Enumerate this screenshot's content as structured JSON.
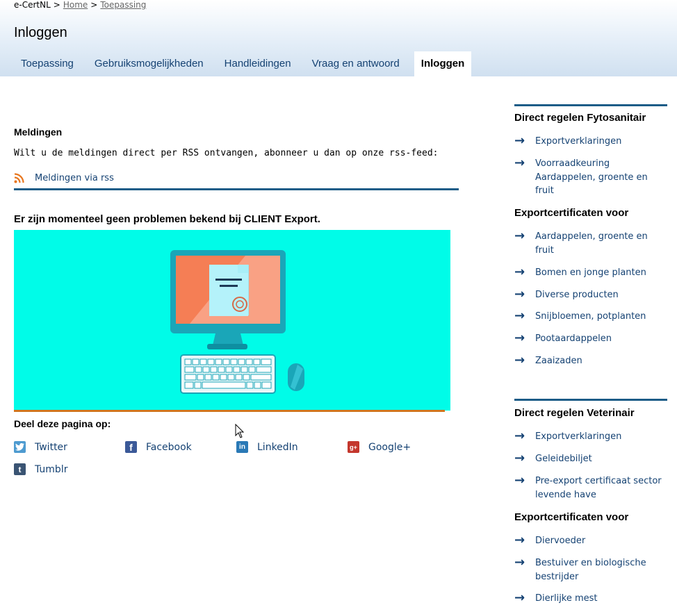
{
  "breadcrumb": {
    "root": "e-CertNL",
    "sep": ">",
    "home": "Home",
    "current": "Toepassing"
  },
  "page_title": "Inloggen",
  "tabs": [
    {
      "label": "Toepassing"
    },
    {
      "label": "Gebruiksmogelijkheden"
    },
    {
      "label": "Handleidingen"
    },
    {
      "label": "Vraag en antwoord"
    },
    {
      "label": "Inloggen",
      "active": true
    }
  ],
  "main": {
    "meldingen_heading": "Meldingen",
    "meldingen_text": "Wilt u de meldingen direct per RSS ontvangen, abonneer u dan op onze rss-feed:",
    "rss_link": "Meldingen via rss",
    "status": "Er zijn momenteel geen problemen bekend bij CLIENT Export.",
    "share_heading": "Deel deze pagina op:",
    "share": [
      {
        "label": "Twitter",
        "icon": "twitter-icon",
        "color": "#4e9bd0"
      },
      {
        "label": "Facebook",
        "icon": "facebook-icon",
        "color": "#3b5998"
      },
      {
        "label": "LinkedIn",
        "icon": "linkedin-icon",
        "color": "#2a79b6"
      },
      {
        "label": "Google+",
        "icon": "google-plus-icon",
        "color": "#c4372d"
      },
      {
        "label": "Tumblr",
        "icon": "tumblr-icon",
        "color": "#3a5473"
      }
    ]
  },
  "sidebar": {
    "fyto": {
      "heading": "Direct regelen Fytosanitair",
      "links": [
        "Exportverklaringen",
        "Voorraadkeuring Aardappelen, groente en fruit"
      ],
      "sub_heading": "Exportcertificaten voor",
      "sub_links": [
        "Aardappelen, groente en fruit",
        "Bomen en jonge planten",
        "Diverse producten",
        "Snijbloemen, potplanten",
        "Pootaardappelen",
        "Zaaizaden"
      ]
    },
    "vet": {
      "heading": "Direct regelen Veterinair",
      "links": [
        "Exportverklaringen",
        "Geleidebiljet",
        "Pre-export certificaat sector levende have"
      ],
      "sub_heading": "Exportcertificaten voor",
      "sub_links": [
        "Diervoeder",
        "Bestuiver en biologische bestrijder",
        "Dierlijke mest"
      ]
    }
  },
  "colors": {
    "link": "#154273",
    "rule": "#1c5c87",
    "illustration_bg": "#00fce8",
    "accent": "#d0761e"
  }
}
